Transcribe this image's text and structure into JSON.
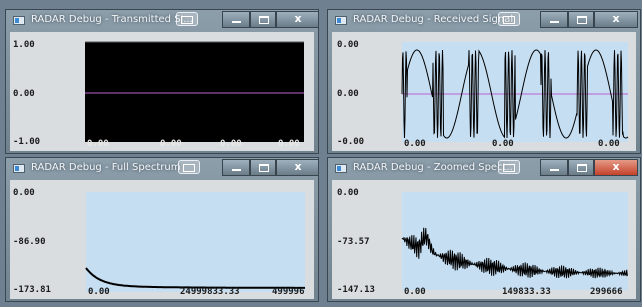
{
  "windows": [
    {
      "id": "transmitted",
      "title": "RADAR Debug - Transmitted Si...",
      "active": false,
      "y_labels": [
        "1.00",
        "0.00",
        "-1.00"
      ],
      "x_labels": [
        "0.00",
        "0.00",
        "0.00",
        "0.00"
      ],
      "plot_background": "#000000",
      "trace_color": "#c060d0"
    },
    {
      "id": "received",
      "title": "RADAR Debug - Received Signal",
      "active": false,
      "y_labels": [
        "0.00",
        "0.00",
        "-0.00"
      ],
      "x_labels": [
        "0.00",
        "0.00",
        "0.00"
      ],
      "plot_background": "#c5def2",
      "trace_color": "#000000"
    },
    {
      "id": "full_spectrum",
      "title": "RADAR Debug - Full Spectrum",
      "active": false,
      "y_labels": [
        "0.00",
        "-86.90",
        "-173.81"
      ],
      "x_labels": [
        "0.00",
        "24999833.33",
        "499996"
      ],
      "plot_background": "#c5def2",
      "trace_color": "#000000"
    },
    {
      "id": "zoomed_spectrum",
      "title": "RADAR Debug - Zoomed Spect...",
      "active": true,
      "y_labels": [
        "0.00",
        "-73.57",
        "-147.13"
      ],
      "x_labels": [
        "0.00",
        "149833.33",
        "299666"
      ],
      "plot_background": "#c5def2",
      "trace_color": "#000000"
    }
  ],
  "controls": {
    "close_glyph": "x"
  }
}
